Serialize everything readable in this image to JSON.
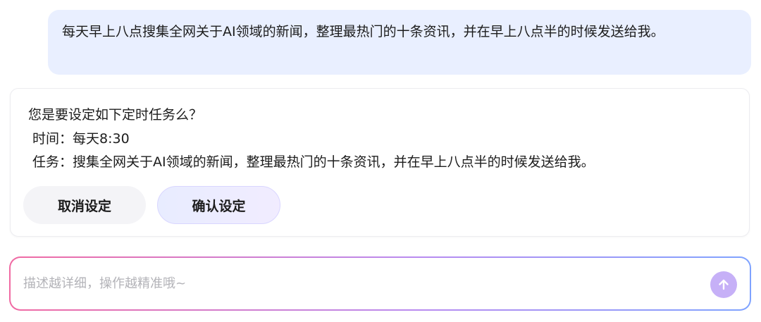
{
  "user_message": {
    "text": "每天早上八点搜集全网关于AI领域的新闻，整理最热门的十条资讯，并在早上八点半的时候发送给我。"
  },
  "assistant": {
    "question": "您是要设定如下定时任务么？",
    "time_line": "时间：每天8:30",
    "task_line": "任务：搜集全网关于AI领域的新闻，整理最热门的十条资讯，并在早上八点半的时候发送给我。",
    "cancel_label": "取消设定",
    "confirm_label": "确认设定"
  },
  "input": {
    "placeholder": "描述越详细，操作越精准哦~",
    "value": ""
  },
  "icons": {
    "send": "arrow-up-icon"
  },
  "colors": {
    "user_bubble": "#e9efff",
    "send_button": "#c6b0f7",
    "input_border_start": "#f06aa3",
    "input_border_end": "#7fa3ff"
  }
}
